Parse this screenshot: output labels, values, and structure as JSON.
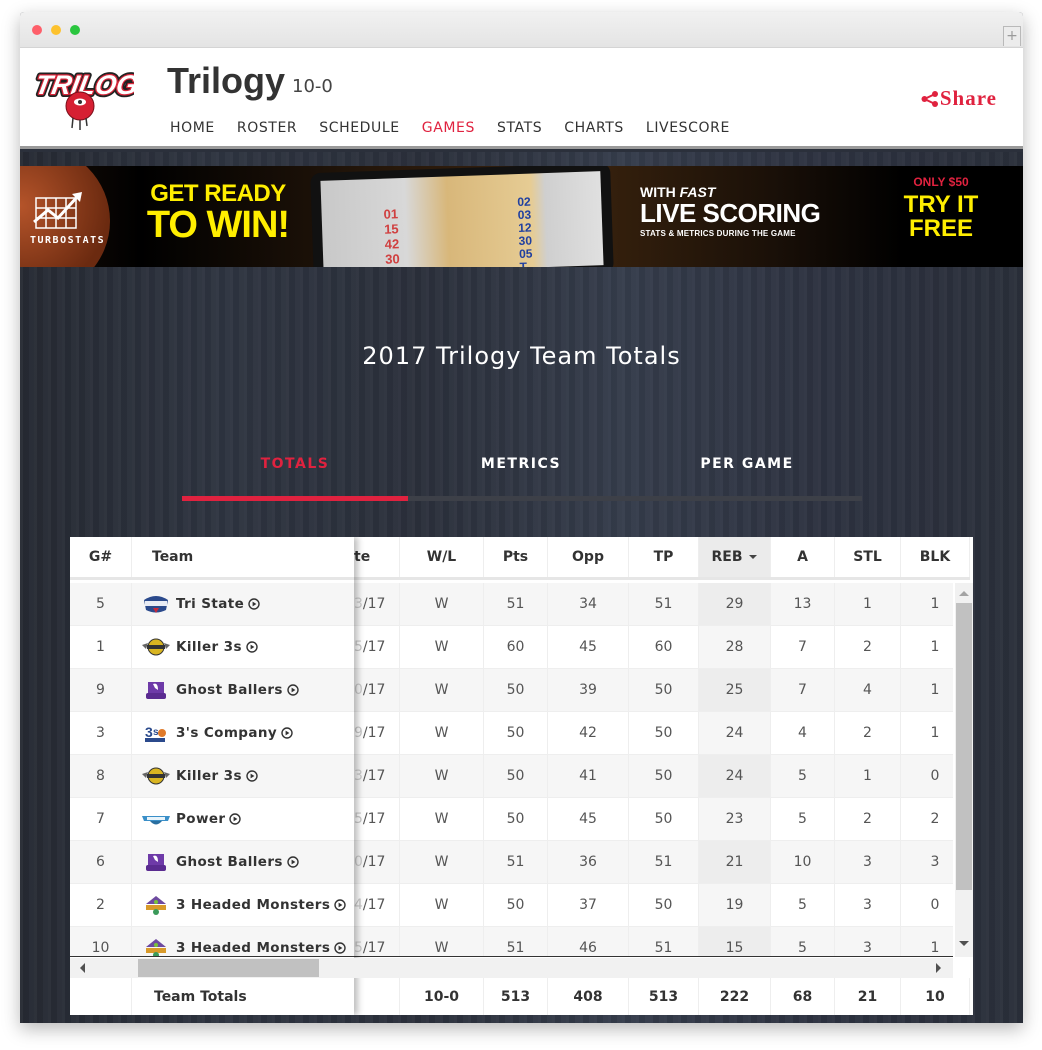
{
  "browser": {
    "new_tab_label": "+"
  },
  "header": {
    "logo_text": "TRILOGY",
    "team_name": "Trilogy",
    "record": "10-0",
    "share_label": "Share",
    "nav": [
      {
        "label": "HOME",
        "active": false
      },
      {
        "label": "ROSTER",
        "active": false
      },
      {
        "label": "SCHEDULE",
        "active": false
      },
      {
        "label": "GAMES",
        "active": true
      },
      {
        "label": "STATS",
        "active": false
      },
      {
        "label": "CHARTS",
        "active": false
      },
      {
        "label": "LIVESCORE",
        "active": false
      }
    ]
  },
  "banner": {
    "brand": "TURBOSTATS",
    "headline_1": "GET READY",
    "headline_2": "TO WIN!",
    "tablet_numbers_left": [
      "01",
      "15",
      "42",
      "30"
    ],
    "tablet_numbers_right": [
      "02",
      "03",
      "12",
      "30",
      "05",
      "T"
    ],
    "live_line_1": "WITH",
    "live_line_1_em": "FAST",
    "live_line_2": "LIVE SCORING",
    "live_line_3": "STATS & METRICS DURING THE GAME",
    "price": "ONLY $50",
    "cta_1": "TRY IT",
    "cta_2": "FREE"
  },
  "page": {
    "heading": "2017 Trilogy Team Totals",
    "tabs": [
      {
        "label": "TOTALS",
        "active": true
      },
      {
        "label": "METRICS",
        "active": false
      },
      {
        "label": "PER GAME",
        "active": false
      }
    ]
  },
  "table": {
    "columns": {
      "gnum": "G#",
      "team": "Team",
      "date": "te",
      "wl": "W/L",
      "pts": "Pts",
      "opp": "Opp",
      "tp": "TP",
      "reb": "REB",
      "a": "A",
      "stl": "STL",
      "blk": "BLK"
    },
    "sorted_column": "REB",
    "sort_direction": "descending",
    "rows": [
      {
        "gnum": "5",
        "team": "Tri State",
        "logo": "tri-state-logo",
        "date_ghost": "3",
        "date": "/17",
        "wl": "W",
        "pts": "51",
        "opp": "34",
        "tp": "51",
        "reb": "29",
        "a": "13",
        "stl": "1",
        "blk": "1"
      },
      {
        "gnum": "1",
        "team": "Killer 3s",
        "logo": "killer-3s-logo",
        "date_ghost": "5",
        "date": "/17",
        "wl": "W",
        "pts": "60",
        "opp": "45",
        "tp": "60",
        "reb": "28",
        "a": "7",
        "stl": "2",
        "blk": "1"
      },
      {
        "gnum": "9",
        "team": "Ghost Ballers",
        "logo": "ghost-ballers-logo",
        "date_ghost": "0",
        "date": "/17",
        "wl": "W",
        "pts": "50",
        "opp": "39",
        "tp": "50",
        "reb": "25",
        "a": "7",
        "stl": "4",
        "blk": "1"
      },
      {
        "gnum": "3",
        "team": "3's Company",
        "logo": "3s-company-logo",
        "date_ghost": "9",
        "date": "/17",
        "wl": "W",
        "pts": "50",
        "opp": "42",
        "tp": "50",
        "reb": "24",
        "a": "4",
        "stl": "2",
        "blk": "1"
      },
      {
        "gnum": "8",
        "team": "Killer 3s",
        "logo": "killer-3s-logo",
        "date_ghost": "3",
        "date": "/17",
        "wl": "W",
        "pts": "50",
        "opp": "41",
        "tp": "50",
        "reb": "24",
        "a": "5",
        "stl": "1",
        "blk": "0"
      },
      {
        "gnum": "7",
        "team": "Power",
        "logo": "power-logo",
        "date_ghost": "5",
        "date": "/17",
        "wl": "W",
        "pts": "50",
        "opp": "45",
        "tp": "50",
        "reb": "23",
        "a": "5",
        "stl": "2",
        "blk": "2"
      },
      {
        "gnum": "6",
        "team": "Ghost Ballers",
        "logo": "ghost-ballers-logo",
        "date_ghost": "0",
        "date": "/17",
        "wl": "W",
        "pts": "51",
        "opp": "36",
        "tp": "51",
        "reb": "21",
        "a": "10",
        "stl": "3",
        "blk": "3"
      },
      {
        "gnum": "2",
        "team": "3 Headed Monsters",
        "logo": "3-headed-monsters-logo",
        "date_ghost": "4",
        "date": "/17",
        "wl": "W",
        "pts": "50",
        "opp": "37",
        "tp": "50",
        "reb": "19",
        "a": "5",
        "stl": "3",
        "blk": "0"
      },
      {
        "gnum": "10",
        "team": "3 Headed Monsters",
        "logo": "3-headed-monsters-logo",
        "date_ghost": "5",
        "date": "/17",
        "wl": "W",
        "pts": "51",
        "opp": "46",
        "tp": "51",
        "reb": "15",
        "a": "5",
        "stl": "3",
        "blk": "1"
      }
    ],
    "totals": {
      "label": "Team Totals",
      "wl": "10-0",
      "pts": "513",
      "opp": "408",
      "tp": "513",
      "reb": "222",
      "a": "68",
      "stl": "21",
      "blk": "10"
    }
  },
  "colors": {
    "accent": "#e0223f",
    "banner_yellow": "#ffee00",
    "text_dark": "#333333"
  }
}
